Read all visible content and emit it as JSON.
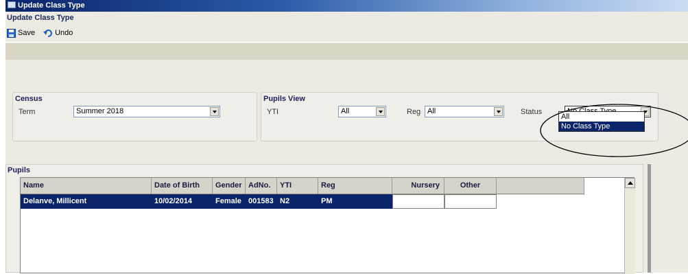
{
  "window": {
    "title": "Update Class Type"
  },
  "header": {
    "title": "Update Class Type"
  },
  "toolbar": {
    "save_label": "Save",
    "undo_label": "Undo"
  },
  "census": {
    "group_title": "Census",
    "term_label": "Term",
    "term_value": "Summer 2018"
  },
  "pupils_view": {
    "group_title": "Pupils View",
    "yti_label": "YTI",
    "yti_value": "All",
    "reg_label": "Reg",
    "reg_value": "All",
    "status_label": "Status",
    "status_value": "No Class Type",
    "status_options": [
      "All",
      "No Class Type"
    ],
    "status_selected_index": 1
  },
  "pupils": {
    "title": "Pupils",
    "columns": [
      "Name",
      "Date of Birth",
      "Gender",
      "AdNo.",
      "YTI",
      "Reg",
      "Nursery",
      "Other"
    ],
    "rows": [
      {
        "name": "Delanve, Millicent",
        "dob": "10/02/2014",
        "gender": "Female",
        "adno": "001583",
        "yti": "N2",
        "reg": "PM",
        "nursery": "",
        "other": ""
      }
    ]
  },
  "colors": {
    "selection": "#0a246a",
    "annotation": "#000000"
  }
}
